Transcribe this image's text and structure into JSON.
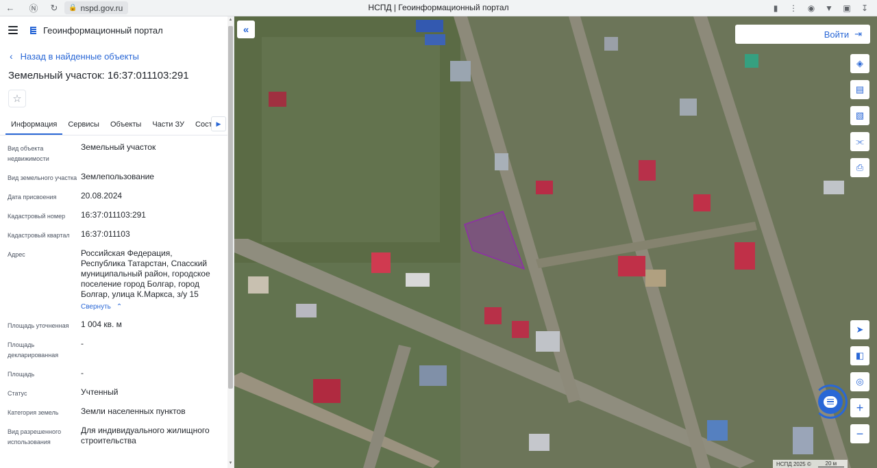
{
  "browser": {
    "url": "nspd.gov.ru",
    "tab_title": "НСПД | Геоинформационный портал"
  },
  "sidebar": {
    "portal_title": "Геоинформационный портал",
    "back_link": "Назад в найденные объекты",
    "object_title": "Земельный участок: 16:37:011103:291",
    "tabs": [
      {
        "label": "Информация"
      },
      {
        "label": "Сервисы"
      },
      {
        "label": "Объекты"
      },
      {
        "label": "Части ЗУ"
      },
      {
        "label": "Состав"
      }
    ],
    "collapse_link": "Свернуть",
    "properties": [
      {
        "key": "Вид объекта недвижимости",
        "value": "Земельный участок"
      },
      {
        "key": "Вид земельного участка",
        "value": "Землепользование"
      },
      {
        "key": "Дата присвоения",
        "value": "20.08.2024"
      },
      {
        "key": "Кадастровый номер",
        "value": "16:37:011103:291"
      },
      {
        "key": "Кадастровый квартал",
        "value": "16:37:011103"
      },
      {
        "key": "Адрес",
        "value": "Российская Федерация, Республика Татарстан, Спасский муниципальный район, городское поселение город Болгар, город Болгар, улица К.Маркса, з/у 15"
      },
      {
        "key": "Площадь уточненная",
        "value": "1 004 кв. м"
      },
      {
        "key": "Площадь декларированная",
        "value": "-"
      },
      {
        "key": "Площадь",
        "value": "-"
      },
      {
        "key": "Статус",
        "value": "Учтенный"
      },
      {
        "key": "Категория земель",
        "value": "Земли населенных пунктов"
      },
      {
        "key": "Вид разрешенного использования",
        "value": "Для индивидуального жилищного строительства"
      }
    ]
  },
  "map": {
    "login_label": "Войти",
    "attribution": "НСПД 2025 ©",
    "scale_label": "20 м",
    "parcel_color": "#8e2fa6"
  },
  "colors": {
    "accent": "#2967d6"
  }
}
